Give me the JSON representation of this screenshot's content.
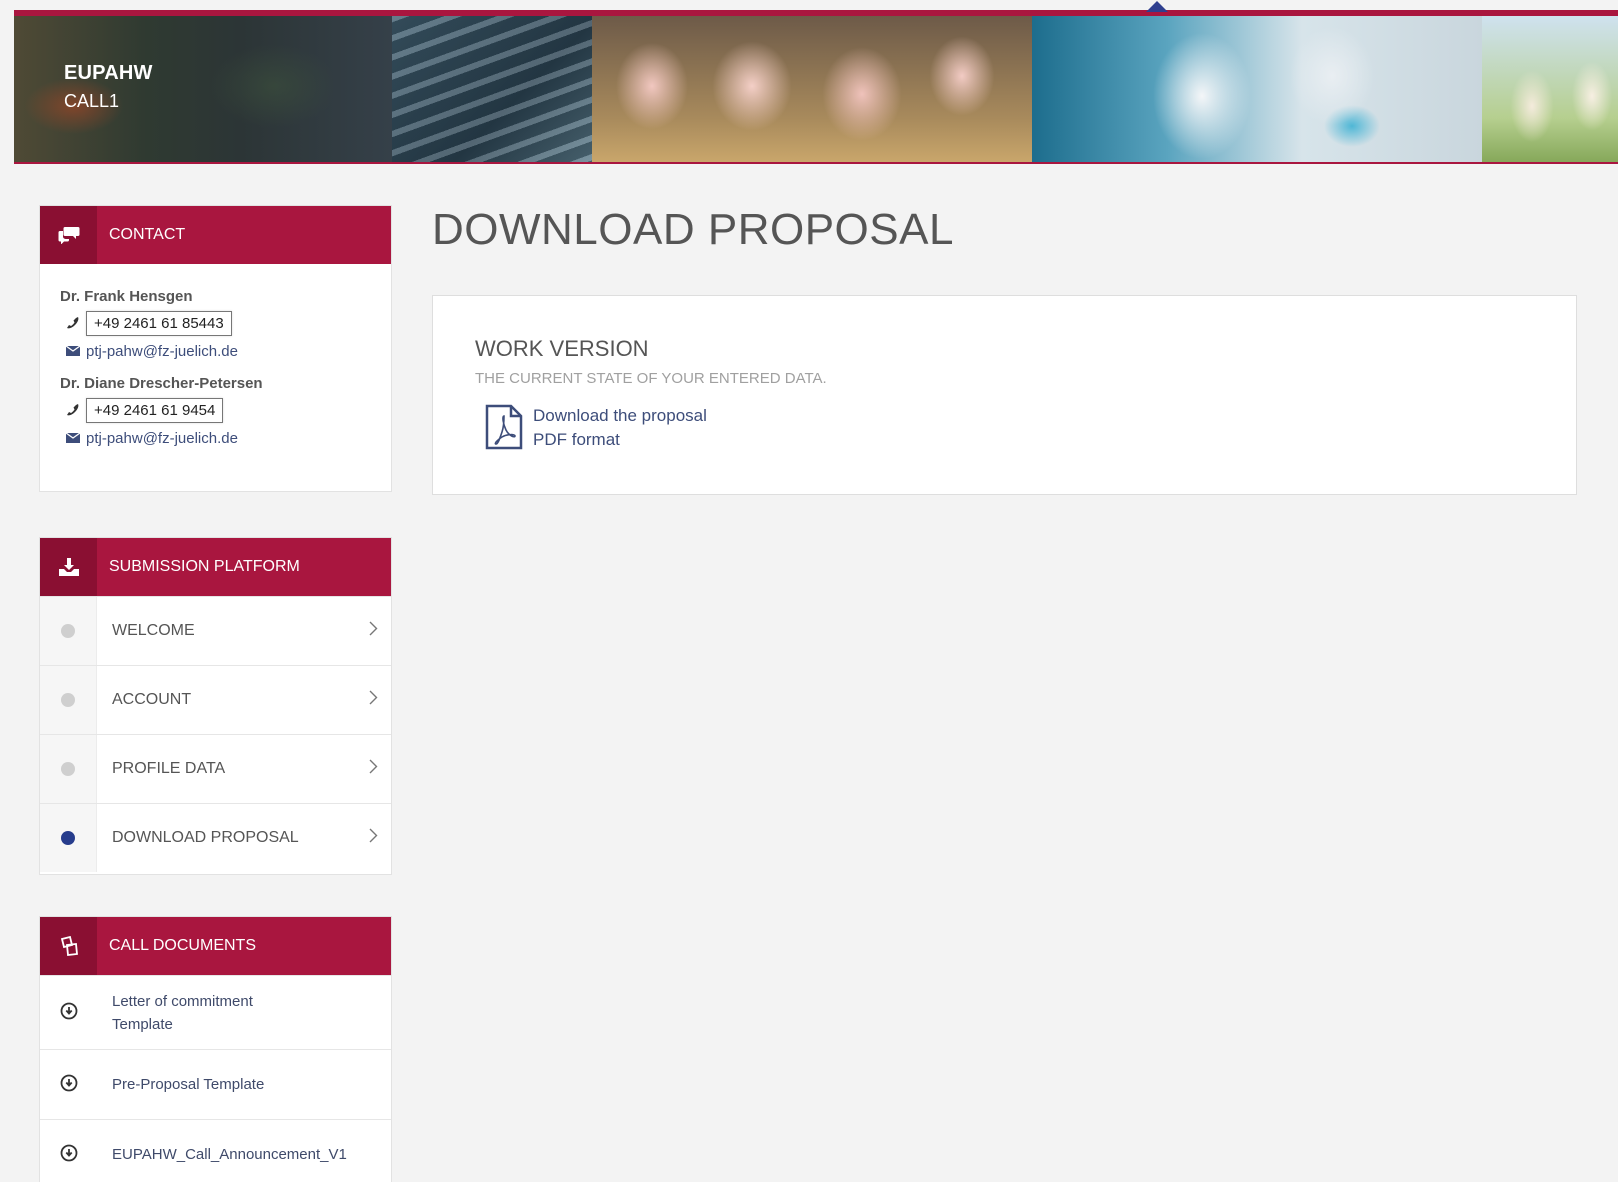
{
  "header": {
    "brand_title": "EUPAHW",
    "brand_subtitle": "CALL1",
    "banner_images": [
      "cow-image",
      "fish-image",
      "pigs-image",
      "lab-image",
      "hens-image"
    ],
    "accent_color": "#a9163f"
  },
  "contact": {
    "title": "CONTACT",
    "people": [
      {
        "name": "Dr. Frank Hensgen",
        "phone": "+49 2461 61 85443",
        "email": "ptj-pahw@fz-juelich.de"
      },
      {
        "name": "Dr. Diane Drescher-Petersen",
        "phone": "+49 2461 61 9454",
        "email": "ptj-pahw@fz-juelich.de"
      }
    ]
  },
  "submission": {
    "title": "SUBMISSION PLATFORM",
    "items": [
      {
        "label": "WELCOME",
        "active": false
      },
      {
        "label": "ACCOUNT",
        "active": false
      },
      {
        "label": "PROFILE DATA",
        "active": false
      },
      {
        "label": "DOWNLOAD PROPOSAL",
        "active": true
      }
    ],
    "active_color": "#263c8c"
  },
  "documents": {
    "title": "CALL DOCUMENTS",
    "items": [
      {
        "label": "Letter of commitment Template"
      },
      {
        "label": "Pre-Proposal Template"
      },
      {
        "label": "EUPAHW_Call_Announcement_V1"
      }
    ]
  },
  "main": {
    "page_title": "DOWNLOAD PROPOSAL",
    "card": {
      "title": "WORK VERSION",
      "subtitle": "THE CURRENT STATE OF YOUR ENTERED DATA.",
      "link_label": "Download the proposal",
      "link_format": "PDF format",
      "icon": "pdf-file-icon"
    }
  }
}
